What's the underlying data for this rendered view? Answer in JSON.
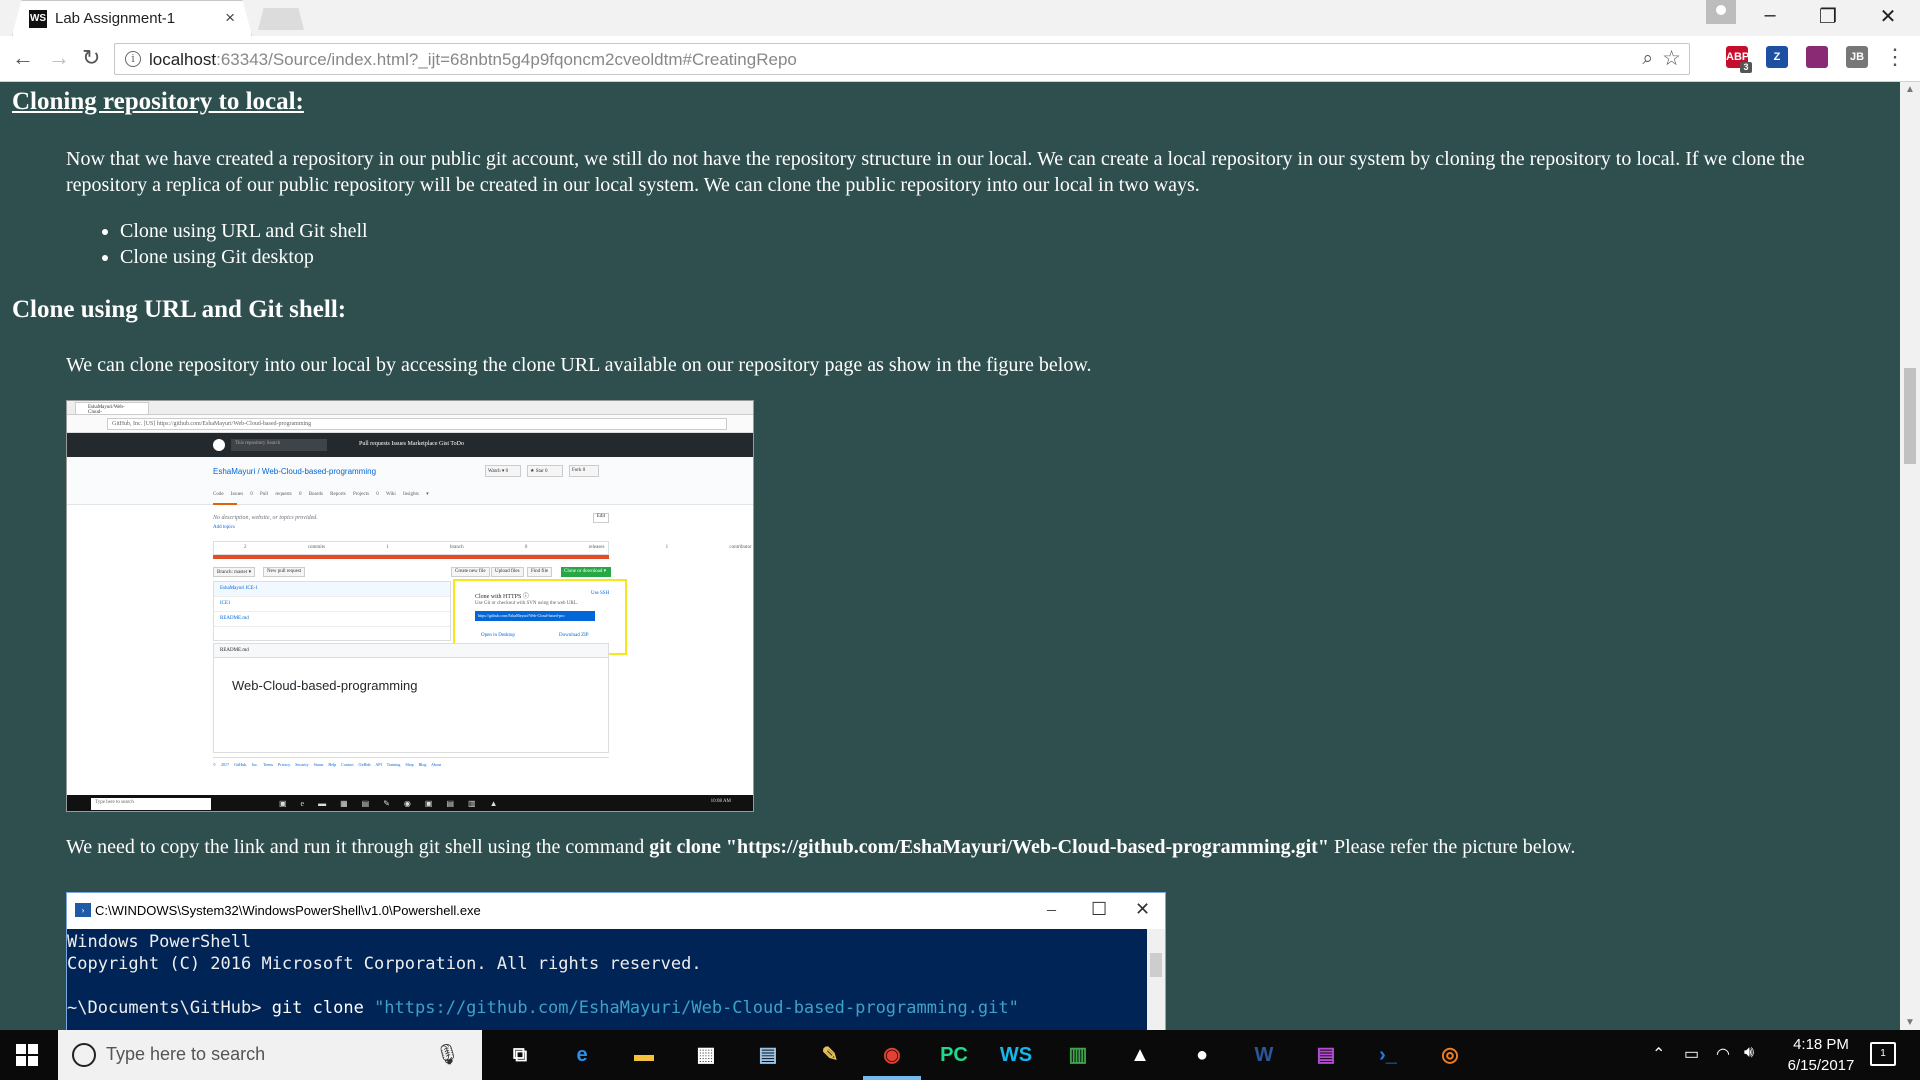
{
  "browser": {
    "tab_title": "Lab Assignment-1",
    "tab_favicon": "WS",
    "tab_close": "×",
    "url_host": "localhost",
    "url_rest": ":63343/Source/index.html?_ijt=68nbtn5g4p9fqoncm2cveoldtm#CreatingRepo",
    "back_icon": "←",
    "forward_icon": "→",
    "reload_icon": "↻",
    "minimize_icon": "–",
    "restore_icon": "❐",
    "close_icon": "✕",
    "extensions": [
      {
        "name": "adblock-icon",
        "label": "ABP",
        "badge": "3",
        "color": "#c70d2c"
      },
      {
        "name": "zotero-icon",
        "label": "Z",
        "badge": "",
        "color": "#1d4fa3"
      },
      {
        "name": "extension-icon",
        "label": "",
        "badge": "",
        "color": "#8a2a75"
      },
      {
        "name": "jetbrains-icon",
        "label": "JB",
        "badge": "",
        "color": "#777777"
      }
    ]
  },
  "content": {
    "section_title": "Cloning repository to local:",
    "intro": "Now that we have created a repository in our public git account, we still do not have the repository structure in our local. We can create a local repository in our system by cloning the repository to local. If we clone the repository a replica of our public repository will be created in our local system. We can clone the public repository into our local in two ways.",
    "bullets": [
      "Clone using URL and Git shell",
      "Clone using Git desktop"
    ],
    "subsection_title": "Clone using URL and Git shell:",
    "clone_desc": "We can clone repository into our local by accessing the clone URL available on our repository page as show in the figure below.",
    "copy_prefix": "We need to copy the link and run it through git shell using the command ",
    "copy_command": "git clone \"https://github.com/EshaMayuri/Web-Cloud-based-programming.git\"",
    "copy_suffix": " Please refer the picture below."
  },
  "github_figure": {
    "tab": "EshaMayuri/Web-Cloud-",
    "address": "GitHub, Inc. [US]   https://github.com/EshaMayuri/Web-Cloud-based-programming",
    "search": "This repository   Search",
    "nav": "Pull requests   Issues   Marketplace   Gist   ToDo",
    "repo_name": "EshaMayuri / Web-Cloud-based-programming",
    "watch": "Watch ▾  0",
    "star": "★ Star  0",
    "fork": "Fork  0",
    "tabs": "Code Issues 0 Pull requests 0 Boards Reports Projects 0 Wiki Insights ▾",
    "description": "No description, website, or topics provided.",
    "topics": "Add topics",
    "edit": "Edit",
    "stats": "2 commits  1 branch  0 releases  1 contributor",
    "branch": "Branch: master ▾",
    "new_pr": "New pull request",
    "create_file": "Create new file",
    "upload": "Upload files",
    "find": "Find file",
    "clone_btn": "Clone or download ▾",
    "files": [
      "EshaMayuri ICE-1",
      "ICE1",
      "README.md"
    ],
    "popup_title": "Clone with HTTPS ⓘ",
    "popup_use_ssh": "Use SSH",
    "popup_sub": "Use Git or checkout with SVN using the web URL.",
    "popup_url": "https://github.com/EshaMayuri/Web-Cloud-based-pro",
    "open_desktop": "Open in Desktop",
    "download_zip": "Download ZIP",
    "readme_head": "README.md",
    "readme_title": "Web-Cloud-based-programming",
    "footer": "© 2017 GitHub, Inc.  Terms  Privacy  Security  Status  Help         Contact GitHub  API  Training  Shop  Blog  About",
    "tb_search": "Type here to search",
    "tb_time": "10:08 AM"
  },
  "powershell": {
    "title": "C:\\WINDOWS\\System32\\WindowsPowerShell\\v1.0\\Powershell.exe",
    "line1": "Windows PowerShell",
    "line2": "Copyright (C) 2016 Microsoft Corporation. All rights reserved.",
    "prompt": "~\\Documents\\GitHub> ",
    "command": "git clone ",
    "url_arg": "\"https://github.com/EshaMayuri/Web-Cloud-based-programming.git\""
  },
  "taskbar": {
    "search_placeholder": "Type here to search",
    "time": "4:18 PM",
    "date": "6/15/2017",
    "notification_count": "1",
    "apps": [
      {
        "name": "task-view-icon",
        "glyph": "⧉",
        "color": "#ffffff"
      },
      {
        "name": "edge-icon",
        "glyph": "e",
        "color": "#2f8fe6"
      },
      {
        "name": "file-explorer-icon",
        "glyph": "▬",
        "color": "#f3c13a"
      },
      {
        "name": "store-icon",
        "glyph": "▦",
        "color": "#ffffff"
      },
      {
        "name": "network-app-icon",
        "glyph": "▤",
        "color": "#9cc3e6"
      },
      {
        "name": "paint-icon",
        "glyph": "✎",
        "color": "#e8c15a"
      },
      {
        "name": "chrome-icon",
        "glyph": "◉",
        "color": "#e34133"
      },
      {
        "name": "pycharm-icon",
        "glyph": "PC",
        "color": "#21d789"
      },
      {
        "name": "webstorm-icon",
        "glyph": "WS",
        "color": "#16b6ec"
      },
      {
        "name": "spreadsheet-icon",
        "glyph": "▥",
        "color": "#3fa34d"
      },
      {
        "name": "photos-icon",
        "glyph": "▲",
        "color": "#ffffff"
      },
      {
        "name": "github-icon",
        "glyph": "●",
        "color": "#ffffff"
      },
      {
        "name": "word-icon",
        "glyph": "W",
        "color": "#2b579a"
      },
      {
        "name": "archive-icon",
        "glyph": "▤",
        "color": "#b44bd1"
      },
      {
        "name": "powershell-icon",
        "glyph": "›_",
        "color": "#2e7bd6"
      },
      {
        "name": "app-orange-icon",
        "glyph": "◎",
        "color": "#f47c20"
      }
    ]
  }
}
